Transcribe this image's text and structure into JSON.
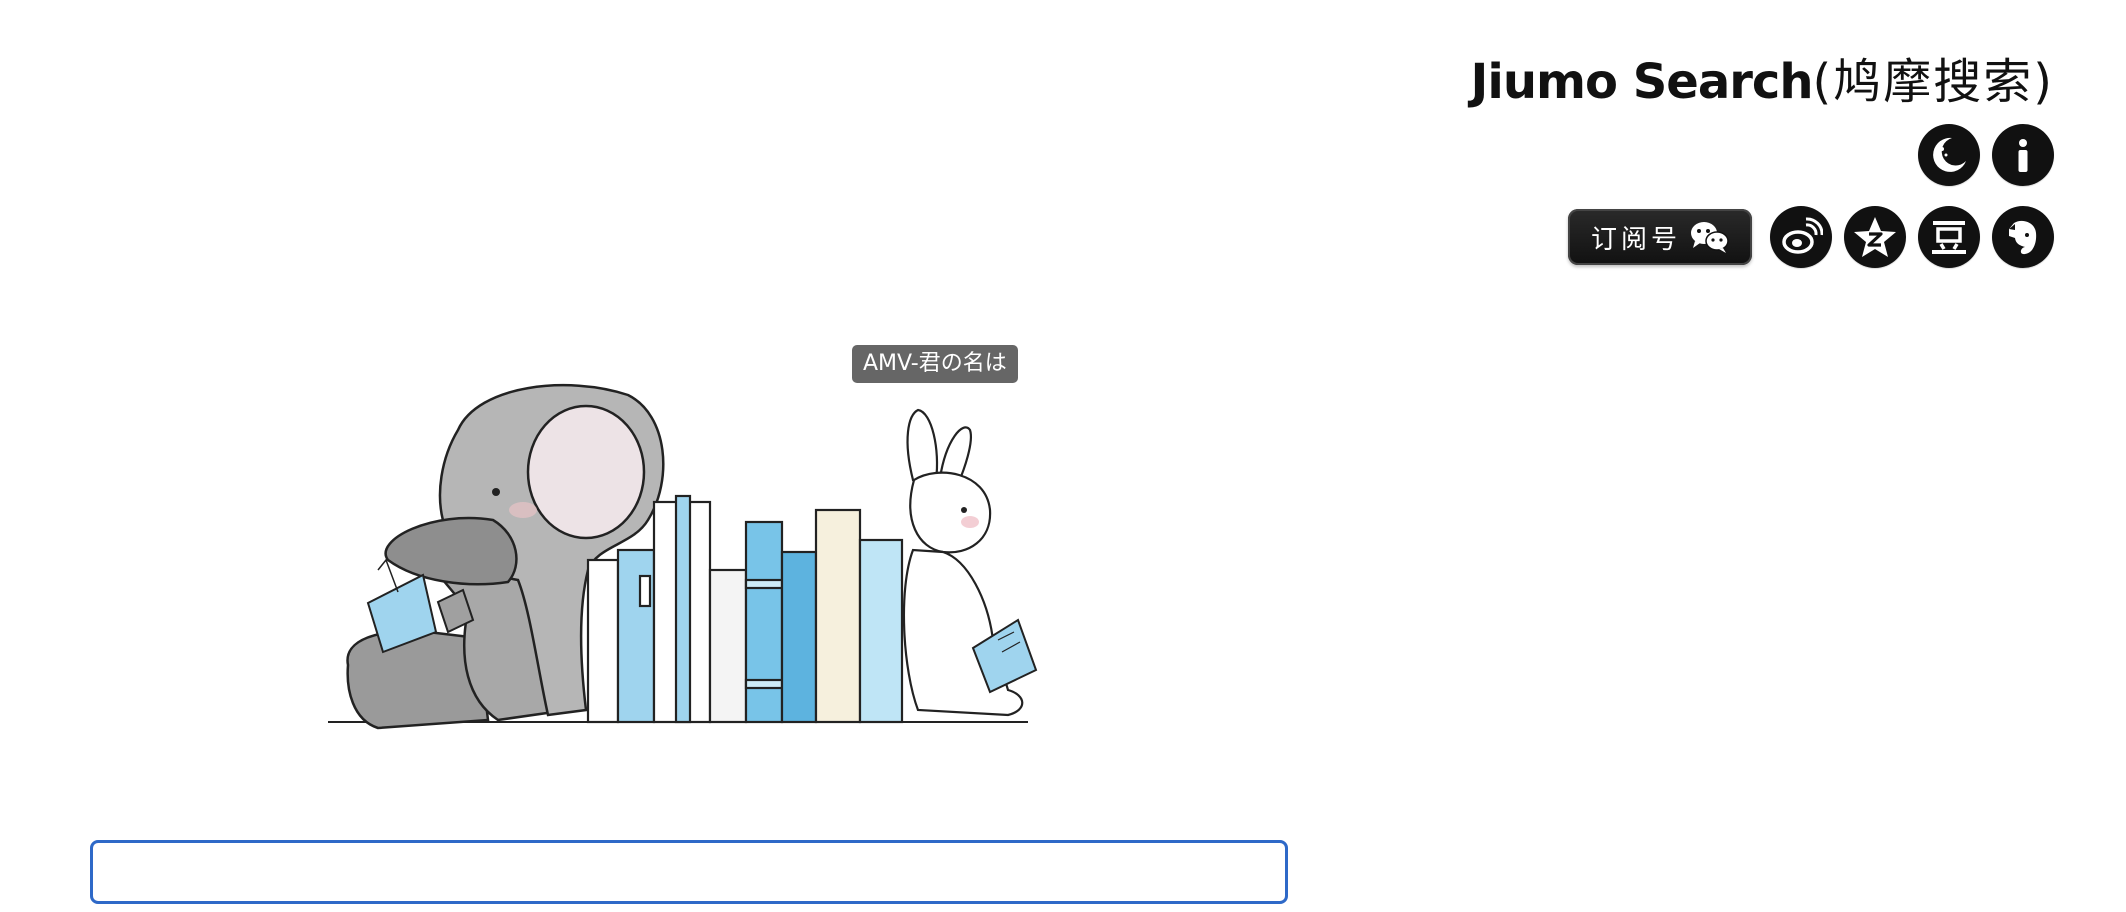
{
  "header": {
    "brand_en": "Jiumo Search",
    "brand_cn": "(鸠摩搜索)"
  },
  "toolbar": {
    "row1": [
      {
        "name": "night-mode-icon"
      },
      {
        "name": "info-icon"
      }
    ],
    "subscribe_label": "订阅号",
    "row2_icons": [
      "wechat-icon",
      "weibo-icon",
      "qzone-icon",
      "douban-icon",
      "evernote-icon"
    ],
    "douban_glyph": "豆"
  },
  "main": {
    "tooltip": "AMV-君の名は",
    "illustration": "elephant-and-rabbit-reading-books"
  },
  "search": {
    "value": "",
    "placeholder": ""
  },
  "colors": {
    "search_border": "#2e69c8",
    "tooltip_bg": "#666666",
    "icon_bg": "#111111"
  }
}
